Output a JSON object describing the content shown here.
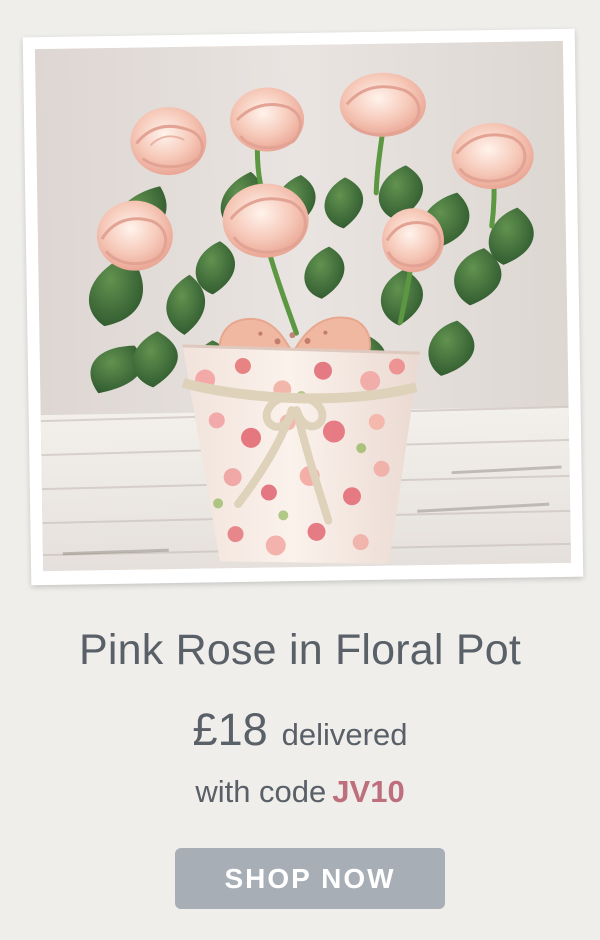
{
  "product": {
    "title": "Pink Rose in Floral Pot",
    "price": "£18",
    "price_suffix": "delivered",
    "code_prefix": "with code",
    "code": "JV10",
    "cta_label": "SHOP NOW"
  },
  "colors": {
    "background": "#efeeeb",
    "text": "#5a6067",
    "code": "#bd6f7c",
    "button": "#a7aeb6",
    "button_text": "#ffffff"
  }
}
